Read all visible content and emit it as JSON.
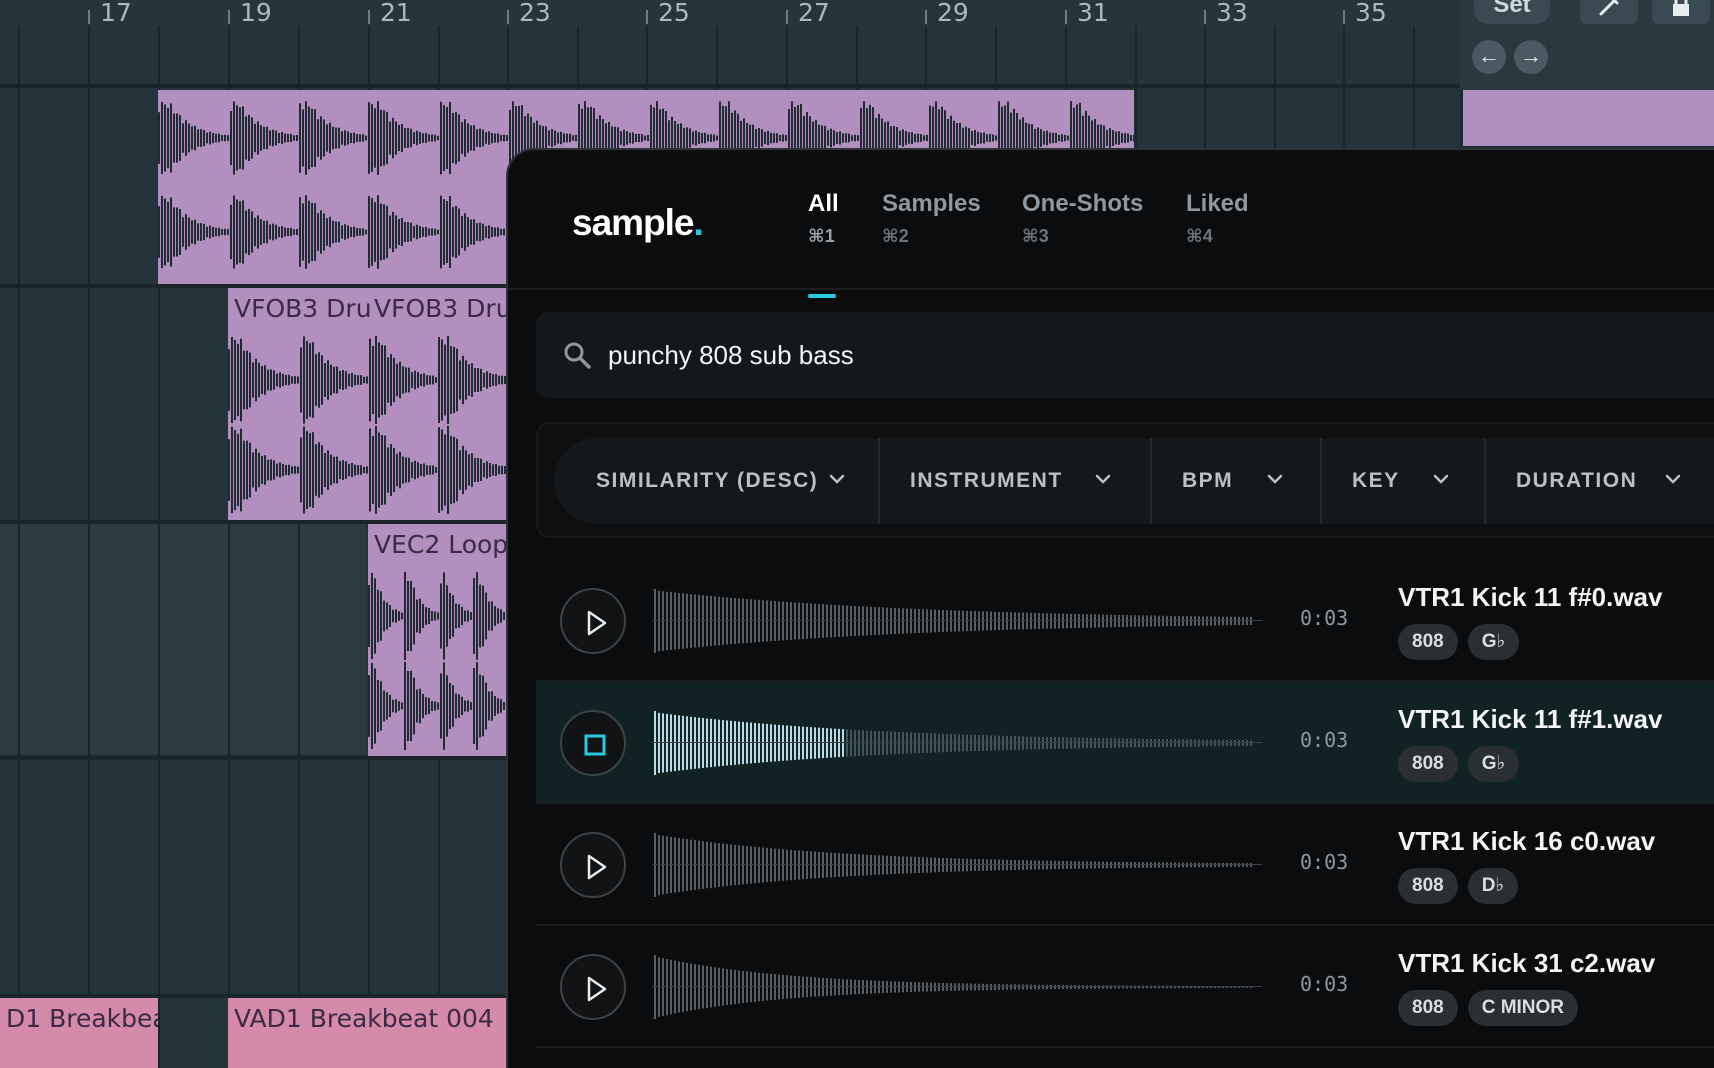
{
  "daw": {
    "ruler": [
      "17",
      "19",
      "21",
      "23",
      "25",
      "27",
      "29",
      "31",
      "33",
      "35"
    ],
    "set_label": "Set",
    "clips": {
      "vfob_1": "VFOB3 Dru",
      "vfob_2": "VFOB3 Dru",
      "vec2": "VEC2 Loop",
      "breakbeat_left": "D1 Breakbea",
      "breakbeat_right": "VAD1 Breakbeat 004"
    }
  },
  "panel": {
    "logo_text": "sample",
    "logo_dot": ".",
    "tabs": [
      {
        "label": "All",
        "shortcut": "⌘1"
      },
      {
        "label": "Samples",
        "shortcut": "⌘2"
      },
      {
        "label": "One-Shots",
        "shortcut": "⌘3"
      },
      {
        "label": "Liked",
        "shortcut": "⌘4"
      }
    ],
    "search_value": "punchy 808 sub bass",
    "filters": [
      "SIMILARITY (DESC)",
      "INSTRUMENT",
      "BPM",
      "KEY",
      "DURATION"
    ],
    "results": [
      {
        "name": "VTR1 Kick 11 f#0.wav",
        "duration": "0:03",
        "tags": [
          "808",
          "G♭"
        ],
        "playing": false
      },
      {
        "name": "VTR1 Kick 11 f#1.wav",
        "duration": "0:03",
        "tags": [
          "808",
          "G♭"
        ],
        "playing": true,
        "progress": 0.32
      },
      {
        "name": "VTR1 Kick 16 c0.wav",
        "duration": "0:03",
        "tags": [
          "808",
          "D♭"
        ],
        "playing": false
      },
      {
        "name": "VTR1 Kick 31 c2.wav",
        "duration": "0:03",
        "tags": [
          "808",
          "C MINOR"
        ],
        "playing": false
      }
    ]
  },
  "colors": {
    "accent": "#29c9e4",
    "clip_purple": "#b28fbf",
    "clip_pink": "#d48aa8",
    "panel_bg": "#0b0c0d"
  }
}
